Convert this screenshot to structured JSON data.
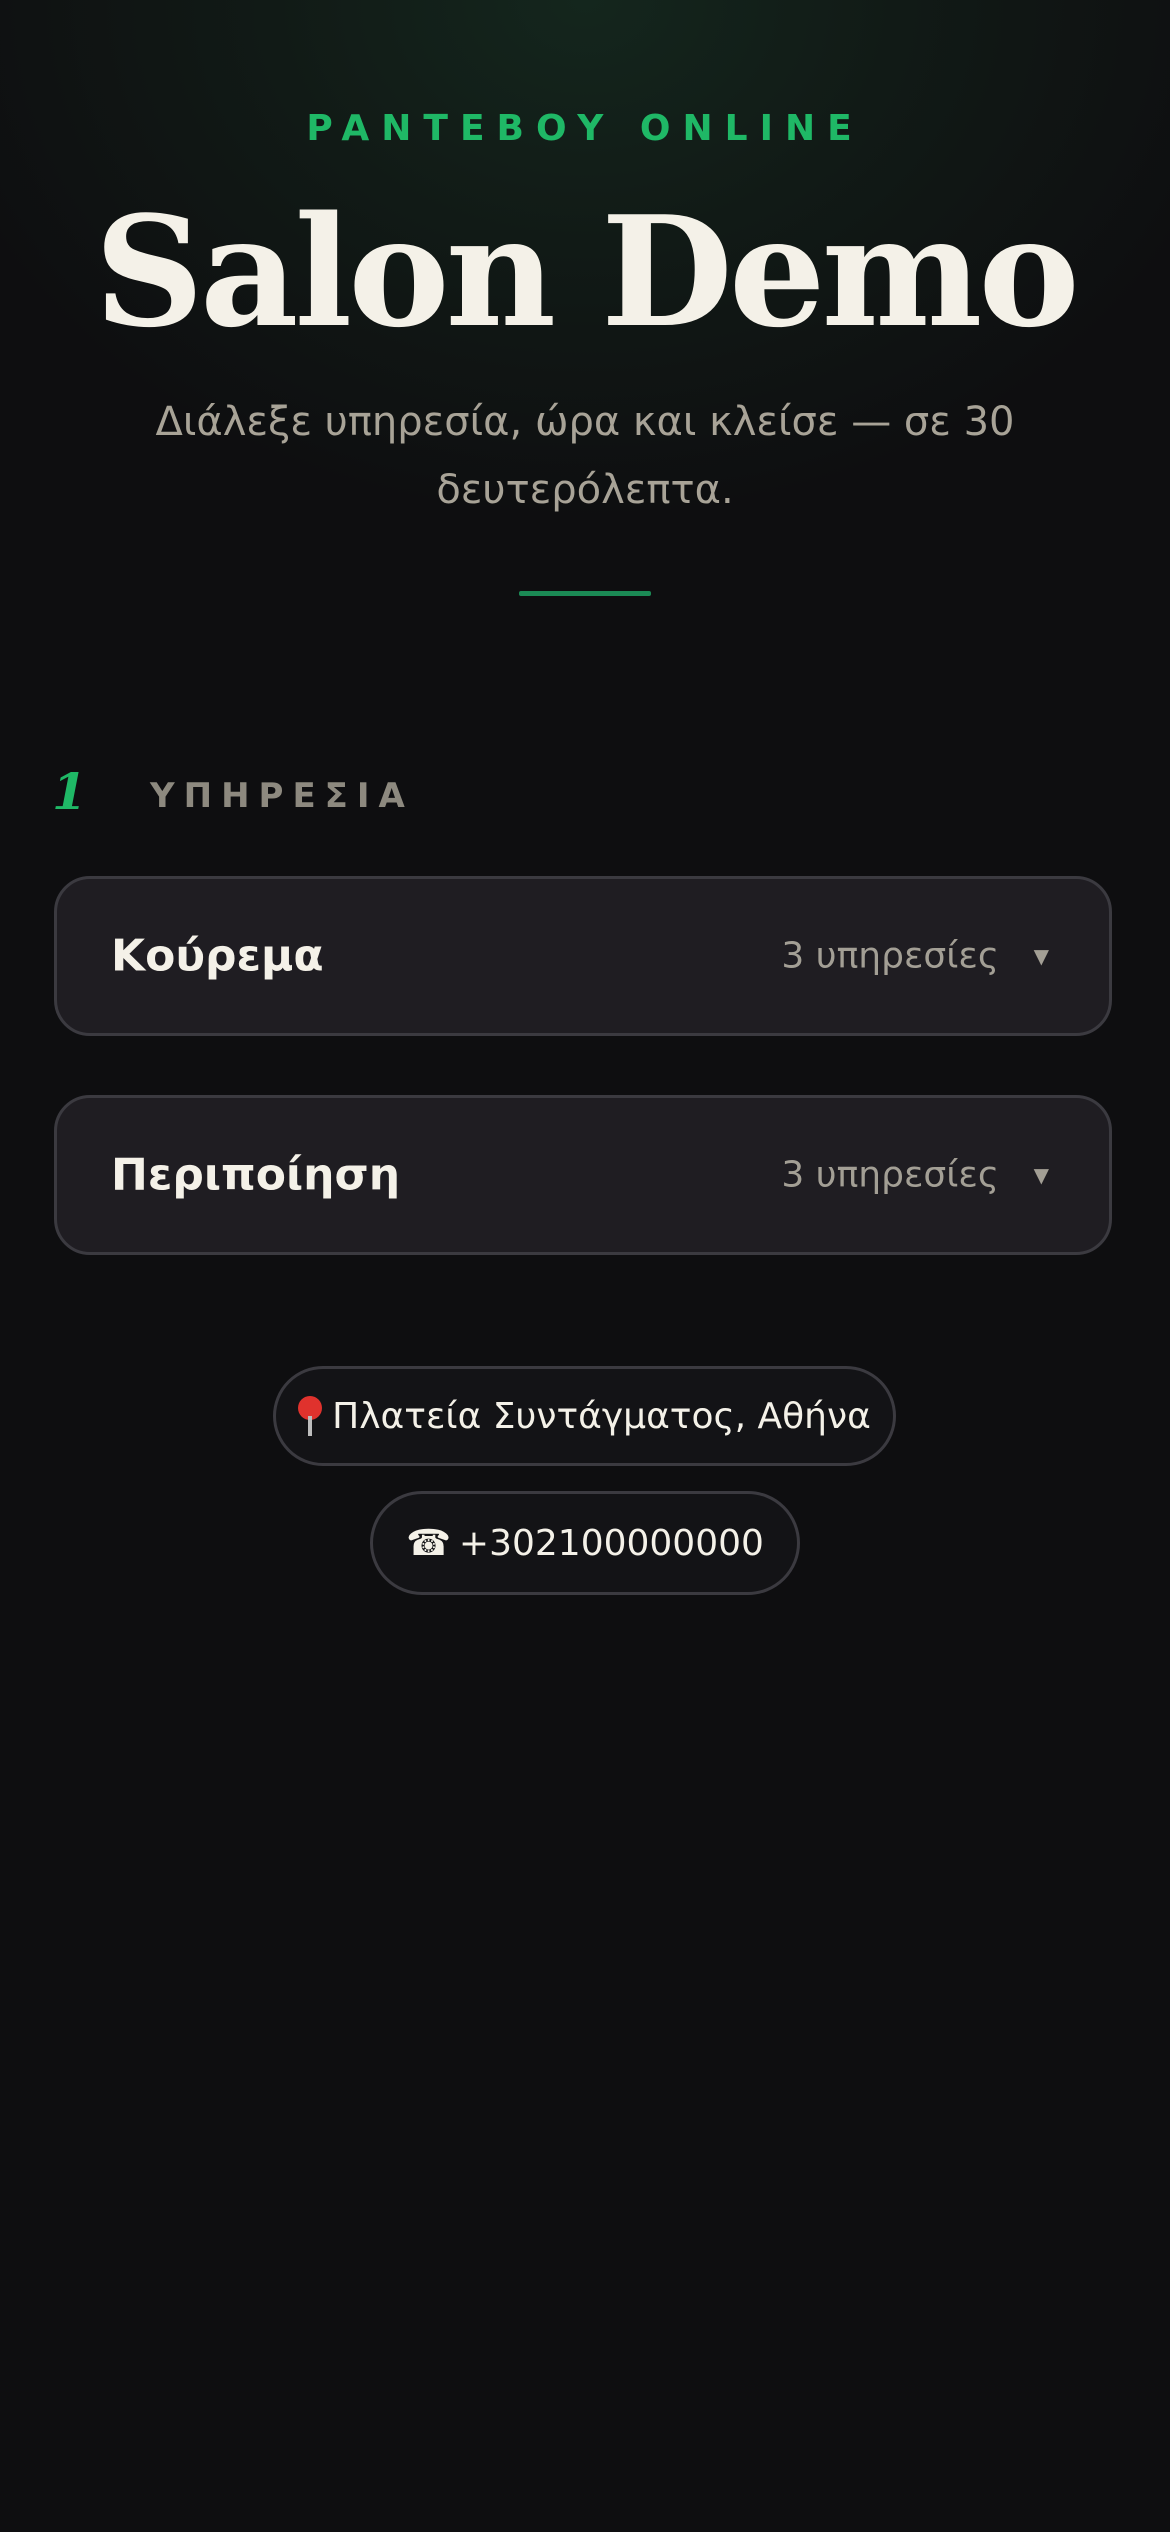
{
  "header": {
    "eyebrow": "PANTEBOY ONLINE",
    "title": "Salon Demo",
    "subtitle": "Διάλεξε υπηρεσία, ώρα και κλείσε — σε 30 δευτερόλεπτα."
  },
  "step": {
    "number": "1",
    "label": "ΥΠΗΡΕΣΙΑ"
  },
  "categories": [
    {
      "name": "Κούρεμα",
      "count": "3 υπηρεσίες",
      "chevron": "▼"
    },
    {
      "name": "Περιποίηση",
      "count": "3 υπηρεσίες",
      "chevron": "▼"
    }
  ],
  "contact": {
    "address": "Πλατεία Συντάγματος, Αθήνα",
    "address_icon": "map-pin-icon",
    "phone": "+302100000000",
    "phone_icon": "phone-icon",
    "phone_glyph": "☎"
  },
  "colors": {
    "accent": "#1fb866",
    "background": "#0e0e10",
    "card": "#1f1d22",
    "border": "#3b3a40"
  }
}
